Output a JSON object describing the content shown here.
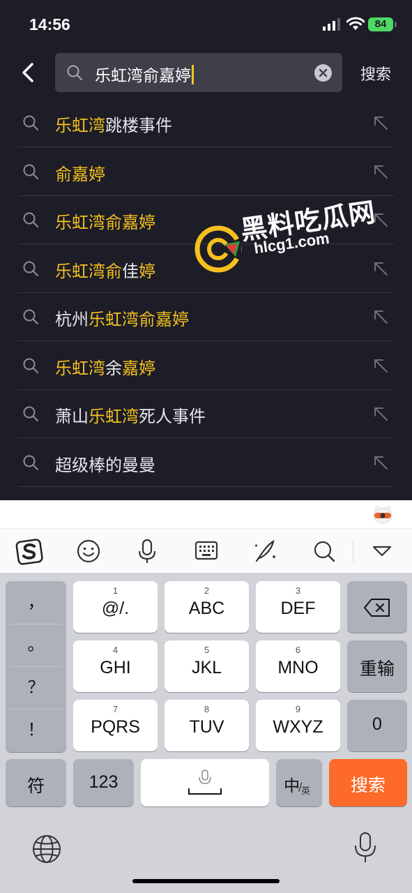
{
  "status_bar": {
    "time": "14:56",
    "battery": "84"
  },
  "header": {
    "query": "乐虹湾俞嘉婷",
    "search_button": "搜索"
  },
  "suggestions": [
    {
      "parts": [
        {
          "t": "乐虹湾",
          "hl": true
        },
        {
          "t": "跳楼事件",
          "hl": false
        }
      ]
    },
    {
      "parts": [
        {
          "t": "俞嘉婷",
          "hl": true
        }
      ]
    },
    {
      "parts": [
        {
          "t": "乐虹湾俞嘉婷",
          "hl": true
        }
      ]
    },
    {
      "parts": [
        {
          "t": "乐虹湾俞",
          "hl": true
        },
        {
          "t": "佳",
          "hl": false
        },
        {
          "t": "婷",
          "hl": true
        }
      ]
    },
    {
      "parts": [
        {
          "t": "杭州",
          "hl": false
        },
        {
          "t": "乐虹湾俞嘉婷",
          "hl": true
        }
      ]
    },
    {
      "parts": [
        {
          "t": "乐虹湾",
          "hl": true
        },
        {
          "t": "余",
          "hl": false
        },
        {
          "t": "嘉婷",
          "hl": true
        }
      ]
    },
    {
      "parts": [
        {
          "t": "萧山",
          "hl": false
        },
        {
          "t": "乐虹湾",
          "hl": true
        },
        {
          "t": "死人事件",
          "hl": false
        }
      ]
    },
    {
      "parts": [
        {
          "t": "超级棒的曼曼",
          "hl": false
        }
      ]
    }
  ],
  "watermark": {
    "name": "黑料吃瓜网",
    "domain": "hlcg1.com"
  },
  "keyboard": {
    "punct": [
      "，",
      "。",
      "？",
      "！"
    ],
    "keys": [
      {
        "num": "1",
        "label": "@/."
      },
      {
        "num": "2",
        "label": "ABC"
      },
      {
        "num": "3",
        "label": "DEF"
      },
      {
        "num": "4",
        "label": "GHI"
      },
      {
        "num": "5",
        "label": "JKL"
      },
      {
        "num": "6",
        "label": "MNO"
      },
      {
        "num": "7",
        "label": "PQRS"
      },
      {
        "num": "8",
        "label": "TUV"
      },
      {
        "num": "9",
        "label": "WXYZ"
      }
    ],
    "reenter": "重输",
    "zero": "0",
    "symbols": "符",
    "numbers": "123",
    "lang_main": "中",
    "lang_sub": "英",
    "submit": "搜索"
  },
  "colors": {
    "highlight": "#f5c01e",
    "submit": "#fd6a29",
    "background": "#1c1d27"
  },
  "icons": [
    "back-icon",
    "search-icon",
    "clear-icon",
    "fill-arrow-icon",
    "sogou-logo-icon",
    "emoji-icon",
    "mic-icon",
    "keyboard-icon",
    "handwriting-icon",
    "chevron-down-icon",
    "backspace-icon",
    "globe-icon"
  ]
}
